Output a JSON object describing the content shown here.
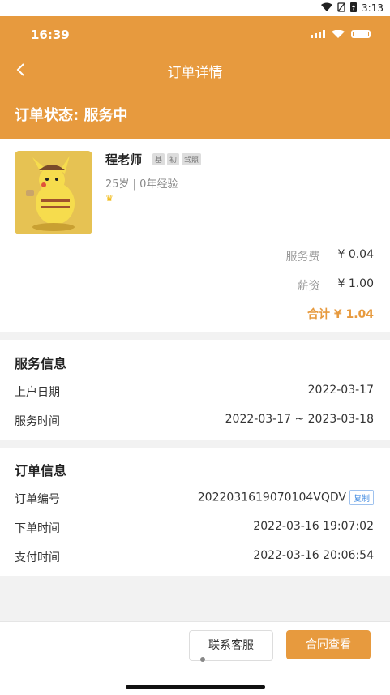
{
  "system": {
    "time": "3:13"
  },
  "inner_status": {
    "time": "16:39"
  },
  "header": {
    "title": "订单详情",
    "order_status": "订单状态: 服务中"
  },
  "profile": {
    "name": "程老师",
    "tags": [
      "基",
      "初",
      "驾照"
    ],
    "meta": "25岁 | 0年经验",
    "crown": "♛"
  },
  "fees": {
    "service_fee_label": "服务费",
    "service_fee_value": "¥ 0.04",
    "salary_label": "薪资",
    "salary_value": "¥ 1.00",
    "total": "合计 ¥ 1.04"
  },
  "service_info": {
    "title": "服务信息",
    "date_label": "上户日期",
    "date_value": "2022-03-17",
    "period_label": "服务时间",
    "period_value": "2022-03-17 ~ 2023-03-18"
  },
  "order_info": {
    "title": "订单信息",
    "no_label": "订单编号",
    "no_value": "2022031619070104VQDV",
    "copy_label": "复制",
    "created_label": "下单时间",
    "created_value": "2022-03-16 19:07:02",
    "paid_label": "支付时间",
    "paid_value": "2022-03-16 20:06:54"
  },
  "actions": {
    "contact_label": "联系客服",
    "contract_label": "合同查看"
  },
  "colors": {
    "accent": "#e79a3e",
    "link": "#4a90e2"
  }
}
